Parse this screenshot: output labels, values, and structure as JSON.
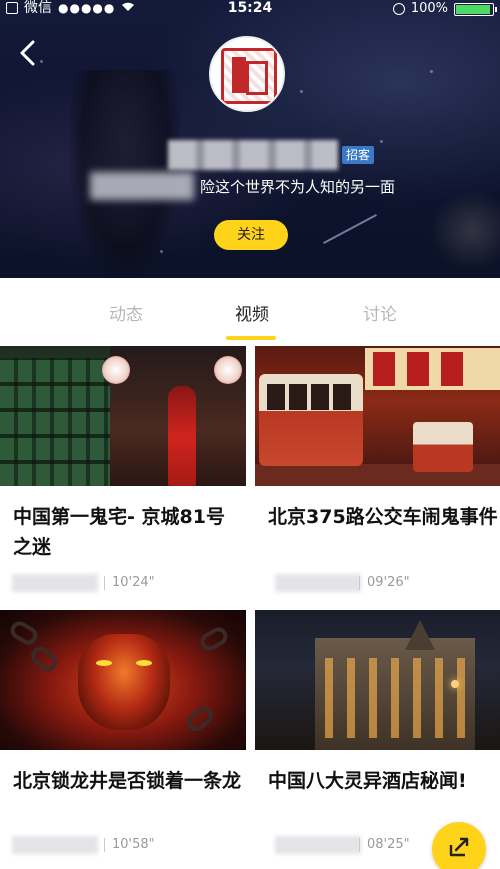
{
  "status_bar": {
    "app": "微信",
    "signal": "●●●●●",
    "time": "15:24",
    "battery": "100%",
    "battery_level": 1.0
  },
  "profile": {
    "badge": "招客",
    "bio": "险这个世界不为人知的另一面",
    "follow_label": "关注"
  },
  "tabs": [
    {
      "label": "动态",
      "active": false
    },
    {
      "label": "视频",
      "active": true
    },
    {
      "label": "讨论",
      "active": false
    }
  ],
  "videos": [
    {
      "title": "中国第一鬼宅- 京城81号之迷",
      "duration": "10'24\""
    },
    {
      "title": "北京375路公交车闹鬼事件",
      "duration": "09'26\""
    },
    {
      "title": "北京锁龙井是否锁着一条龙",
      "duration": "10'58\""
    },
    {
      "title": "中国八大灵异酒店秘闻!",
      "duration": "08'25\""
    }
  ],
  "colors": {
    "accent": "#ffd31a",
    "badge": "#3a78c8",
    "header_bg": "#0e1430"
  },
  "icons": {
    "back": "chevron-left-icon",
    "share": "share-icon"
  }
}
